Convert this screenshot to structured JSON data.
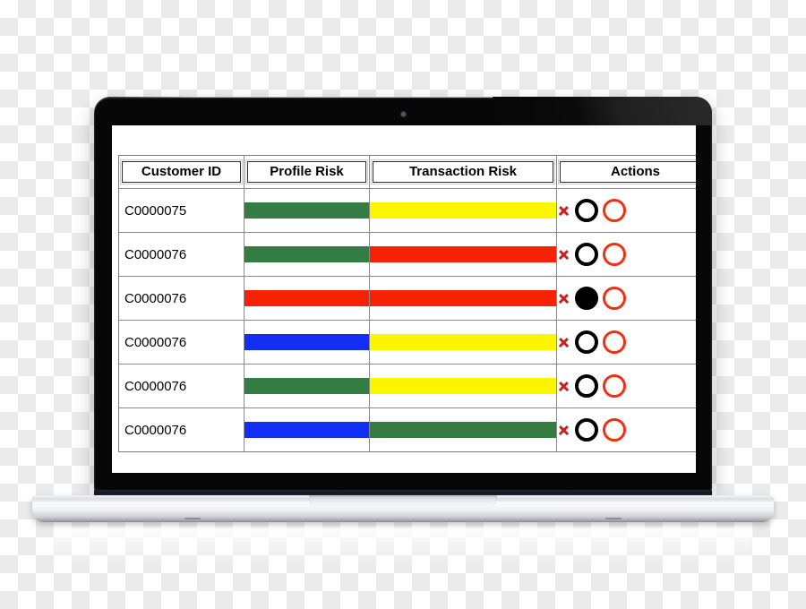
{
  "device": {
    "type": "laptop-mockup",
    "camera_icon": "camera-dot-icon"
  },
  "table": {
    "columns": [
      {
        "key": "customer_id",
        "label": "Customer ID"
      },
      {
        "key": "profile_risk",
        "label": "Profile Risk"
      },
      {
        "key": "transaction_risk",
        "label": "Transaction Risk"
      },
      {
        "key": "actions",
        "label": "Actions"
      }
    ],
    "risk_colors": {
      "green": "#337c42",
      "yellow": "#fcf500",
      "red": "#f72205",
      "blue": "#1230f5"
    },
    "action_icons": {
      "delete": "close-x-icon",
      "flag_black": "black-circle-icon",
      "flag_red": "red-circle-icon"
    },
    "rows": [
      {
        "customer_id": "C0000075",
        "profile_risk": {
          "level": "green",
          "color": "#337c42",
          "width_pct": 100
        },
        "transaction_risk": {
          "level": "yellow",
          "color": "#fcf500",
          "width_pct": 100
        },
        "actions": {
          "delete": true,
          "black_circle": "open",
          "red_circle": "open"
        }
      },
      {
        "customer_id": "C0000076",
        "profile_risk": {
          "level": "green",
          "color": "#337c42",
          "width_pct": 100
        },
        "transaction_risk": {
          "level": "red",
          "color": "#f72205",
          "width_pct": 100
        },
        "actions": {
          "delete": true,
          "black_circle": "open",
          "red_circle": "open"
        }
      },
      {
        "customer_id": "C0000076",
        "profile_risk": {
          "level": "red",
          "color": "#f72205",
          "width_pct": 100
        },
        "transaction_risk": {
          "level": "red",
          "color": "#f72205",
          "width_pct": 100
        },
        "actions": {
          "delete": true,
          "black_circle": "filled",
          "red_circle": "open"
        }
      },
      {
        "customer_id": "C0000076",
        "profile_risk": {
          "level": "blue",
          "color": "#1230f5",
          "width_pct": 100
        },
        "transaction_risk": {
          "level": "yellow",
          "color": "#fcf500",
          "width_pct": 100
        },
        "actions": {
          "delete": true,
          "black_circle": "open",
          "red_circle": "open"
        }
      },
      {
        "customer_id": "C0000076",
        "profile_risk": {
          "level": "green",
          "color": "#337c42",
          "width_pct": 100
        },
        "transaction_risk": {
          "level": "yellow",
          "color": "#fcf500",
          "width_pct": 100
        },
        "actions": {
          "delete": true,
          "black_circle": "open",
          "red_circle": "open"
        }
      },
      {
        "customer_id": "C0000076",
        "profile_risk": {
          "level": "blue",
          "color": "#1230f5",
          "width_pct": 100
        },
        "transaction_risk": {
          "level": "green",
          "color": "#337c42",
          "width_pct": 100
        },
        "actions": {
          "delete": true,
          "black_circle": "open",
          "red_circle": "open"
        }
      }
    ]
  }
}
